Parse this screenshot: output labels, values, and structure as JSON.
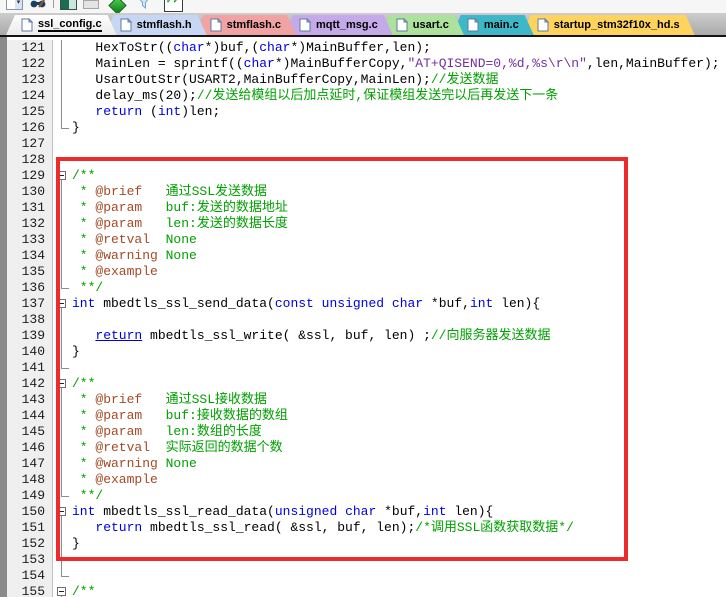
{
  "window": {
    "toolbar": {
      "icons": [
        {
          "name": "dropdown-select"
        },
        {
          "name": "find-in-files-icon"
        },
        {
          "name": "separator"
        },
        {
          "name": "configure-target-icon"
        },
        {
          "name": "window-icon"
        },
        {
          "name": "diamond-icon"
        },
        {
          "name": "filter-icon"
        },
        {
          "name": "manage-items-icon"
        }
      ]
    }
  },
  "tabs": [
    {
      "name": "tab-ssl-config-c",
      "label": "ssl_config.c",
      "color": "",
      "active": true
    },
    {
      "name": "tab-stmflash-h",
      "label": "stmflash.h",
      "color": "#c7d6f3",
      "active": false
    },
    {
      "name": "tab-stmflash-c",
      "label": "stmflash.c",
      "color": "#f1a3a3",
      "active": false
    },
    {
      "name": "tab-mqtt-msg-c",
      "label": "mqtt_msg.c",
      "color": "#c4aae8",
      "active": false
    },
    {
      "name": "tab-usart-c",
      "label": "usart.c",
      "color": "#ace29c",
      "active": false
    },
    {
      "name": "tab-main-c",
      "label": "main.c",
      "color": "#3eb8c8",
      "active": false
    },
    {
      "name": "tab-startup-stm32f10x-hd-s",
      "label": "startup_stm32f10x_hd.s",
      "color": "#ffd45e",
      "active": false
    }
  ],
  "editor": {
    "syntax_colors": {
      "plain": "#000000",
      "keyword": "#0000e0",
      "string": "#7030a0",
      "comment": "#00a000",
      "doxygen_tag": "#a34a24"
    },
    "lines": [
      {
        "num": "121",
        "fold": "line",
        "segments": [
          [
            "   HexToStr((",
            "p"
          ],
          [
            "char",
            "k"
          ],
          [
            "*)buf,(",
            "p"
          ],
          [
            "char",
            "k"
          ],
          [
            "*)MainBuffer,len);",
            "p"
          ]
        ]
      },
      {
        "num": "122",
        "fold": "line",
        "segments": [
          [
            "   MainLen = sprintf((",
            "p"
          ],
          [
            "char",
            "k"
          ],
          [
            "*)MainBufferCopy,",
            "p"
          ],
          [
            "\"AT+QISEND=0,%d,%s\\r\\n\"",
            "s"
          ],
          [
            ",len,MainBuffer);",
            "p"
          ]
        ]
      },
      {
        "num": "123",
        "fold": "line",
        "segments": [
          [
            "   UsartOutStr(USART2,MainBufferCopy,MainLen);",
            "p"
          ],
          [
            "//发送数据",
            "c"
          ]
        ]
      },
      {
        "num": "124",
        "fold": "line",
        "segments": [
          [
            "   delay_ms(20);",
            "p"
          ],
          [
            "//发送给模组以后加点延时,保证模组发送完以后再发送下一条",
            "c"
          ]
        ]
      },
      {
        "num": "125",
        "fold": "line",
        "segments": [
          [
            "   ",
            "p"
          ],
          [
            "return",
            "k"
          ],
          [
            " (",
            "p"
          ],
          [
            "int",
            "k"
          ],
          [
            ")len;",
            "p"
          ]
        ]
      },
      {
        "num": "126",
        "fold": "end",
        "segments": [
          [
            "}",
            "p"
          ]
        ]
      },
      {
        "num": "127",
        "fold": "none",
        "segments": []
      },
      {
        "num": "128",
        "fold": "none",
        "segments": []
      },
      {
        "num": "129",
        "fold": "open",
        "segments": [
          [
            "/**",
            "c"
          ]
        ]
      },
      {
        "num": "130",
        "fold": "line",
        "segments": [
          [
            " * ",
            "c"
          ],
          [
            "@brief",
            "d"
          ],
          [
            "   通过SSL发送数据",
            "c"
          ]
        ]
      },
      {
        "num": "131",
        "fold": "line",
        "segments": [
          [
            " * ",
            "c"
          ],
          [
            "@param",
            "d"
          ],
          [
            "   buf:发送的数据地址",
            "c"
          ]
        ]
      },
      {
        "num": "132",
        "fold": "line",
        "segments": [
          [
            " * ",
            "c"
          ],
          [
            "@param",
            "d"
          ],
          [
            "   len:发送的数据长度",
            "c"
          ]
        ]
      },
      {
        "num": "133",
        "fold": "line",
        "segments": [
          [
            " * ",
            "c"
          ],
          [
            "@retval",
            "d"
          ],
          [
            "  None",
            "c"
          ]
        ]
      },
      {
        "num": "134",
        "fold": "line",
        "segments": [
          [
            " * ",
            "c"
          ],
          [
            "@warning",
            "d"
          ],
          [
            " None",
            "c"
          ]
        ]
      },
      {
        "num": "135",
        "fold": "line",
        "segments": [
          [
            " * ",
            "c"
          ],
          [
            "@example",
            "d"
          ]
        ]
      },
      {
        "num": "136",
        "fold": "end",
        "segments": [
          [
            " **/",
            "c"
          ]
        ]
      },
      {
        "num": "137",
        "fold": "open",
        "segments": [
          [
            "int",
            "k"
          ],
          [
            " mbedtls_ssl_send_data(",
            "p"
          ],
          [
            "const",
            "k"
          ],
          [
            " ",
            "p"
          ],
          [
            "unsigned",
            "k"
          ],
          [
            " ",
            "p"
          ],
          [
            "char",
            "k"
          ],
          [
            " *buf,",
            "p"
          ],
          [
            "int",
            "k"
          ],
          [
            " len){",
            "p"
          ]
        ]
      },
      {
        "num": "138",
        "fold": "line",
        "segments": []
      },
      {
        "num": "139",
        "fold": "line",
        "segments": [
          [
            "   ",
            "p"
          ],
          [
            "return",
            "ku"
          ],
          [
            " mbedtls_ssl_write( &ssl, buf, len) ;",
            "p"
          ],
          [
            "//向服务器发送数据",
            "c"
          ]
        ]
      },
      {
        "num": "140",
        "fold": "line",
        "segments": [
          [
            "}",
            "p"
          ]
        ]
      },
      {
        "num": "141",
        "fold": "end",
        "segments": []
      },
      {
        "num": "142",
        "fold": "open",
        "segments": [
          [
            "/**",
            "c"
          ]
        ]
      },
      {
        "num": "143",
        "fold": "line",
        "segments": [
          [
            " * ",
            "c"
          ],
          [
            "@brief",
            "d"
          ],
          [
            "   通过SSL接收数据",
            "c"
          ]
        ]
      },
      {
        "num": "144",
        "fold": "line",
        "segments": [
          [
            " * ",
            "c"
          ],
          [
            "@param",
            "d"
          ],
          [
            "   buf:接收数据的数组",
            "c"
          ]
        ]
      },
      {
        "num": "145",
        "fold": "line",
        "segments": [
          [
            " * ",
            "c"
          ],
          [
            "@param",
            "d"
          ],
          [
            "   len:数组的长度",
            "c"
          ]
        ]
      },
      {
        "num": "146",
        "fold": "line",
        "segments": [
          [
            " * ",
            "c"
          ],
          [
            "@retval",
            "d"
          ],
          [
            "  实际返回的数据个数",
            "c"
          ]
        ]
      },
      {
        "num": "147",
        "fold": "line",
        "segments": [
          [
            " * ",
            "c"
          ],
          [
            "@warning",
            "d"
          ],
          [
            " None",
            "c"
          ]
        ]
      },
      {
        "num": "148",
        "fold": "line",
        "segments": [
          [
            " * ",
            "c"
          ],
          [
            "@example",
            "d"
          ]
        ]
      },
      {
        "num": "149",
        "fold": "end",
        "segments": [
          [
            " **/",
            "c"
          ]
        ]
      },
      {
        "num": "150",
        "fold": "open",
        "segments": [
          [
            "int",
            "k"
          ],
          [
            " mbedtls_ssl_read_data(",
            "p"
          ],
          [
            "unsigned",
            "k"
          ],
          [
            " ",
            "p"
          ],
          [
            "char",
            "k"
          ],
          [
            " *buf,",
            "p"
          ],
          [
            "int",
            "k"
          ],
          [
            " len){",
            "p"
          ]
        ]
      },
      {
        "num": "151",
        "fold": "line",
        "segments": [
          [
            "   ",
            "p"
          ],
          [
            "return",
            "k"
          ],
          [
            " mbedtls_ssl_read( &ssl, buf, len);",
            "p"
          ],
          [
            "/*调用SSL函数获取数据*/",
            "c"
          ]
        ]
      },
      {
        "num": "152",
        "fold": "line",
        "segments": [
          [
            "}",
            "p"
          ]
        ]
      },
      {
        "num": "153",
        "fold": "line",
        "segments": []
      },
      {
        "num": "154",
        "fold": "end",
        "segments": []
      },
      {
        "num": "155",
        "fold": "open",
        "segments": [
          [
            "/**",
            "c"
          ]
        ]
      }
    ]
  },
  "annotation": {
    "type": "rectangle",
    "color": "#ee2b2b"
  }
}
